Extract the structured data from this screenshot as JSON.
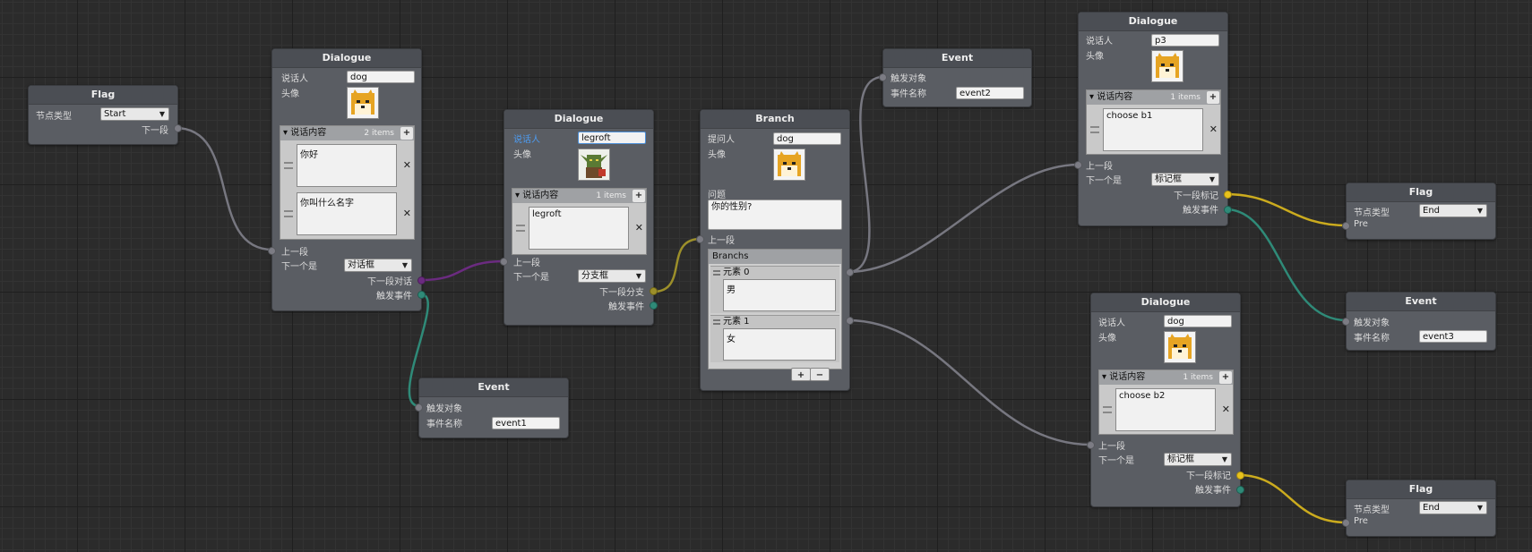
{
  "colors": {
    "background": "#2b2b2b",
    "node": "#5a5d63",
    "wire_default": "#777780",
    "wire_purple": "#6b2b80",
    "wire_teal": "#2f8a78",
    "wire_yellow": "#e8c21c",
    "label_focus": "#4d9bf0"
  },
  "nodes": {
    "flag_start": {
      "title": "Flag",
      "type_label": "节点类型",
      "type_value": "Start",
      "next_label": "下一段"
    },
    "dialogue1": {
      "title": "Dialogue",
      "speaker_label": "说话人",
      "speaker_value": "dog",
      "avatar_label": "头像",
      "avatar_icon": "shiba-dog-avatar",
      "list_label": "说话内容",
      "list_count": "2 items",
      "items": [
        "你好",
        "你叫什么名字"
      ],
      "prev_label": "上一段",
      "next_is_label": "下一个是",
      "next_is_value": "对话框",
      "next_dialogue_label": "下一段对话",
      "trigger_label": "触发事件"
    },
    "event1": {
      "title": "Event",
      "target_label": "触发对象",
      "name_label": "事件名称",
      "name_value": "event1"
    },
    "dialogue2": {
      "title": "Dialogue",
      "speaker_label": "说话人",
      "speaker_value": "legroft",
      "avatar_label": "头像",
      "avatar_icon": "goblin-avatar",
      "list_label": "说话内容",
      "list_count": "1 items",
      "items": [
        "legroft"
      ],
      "prev_label": "上一段",
      "next_is_label": "下一个是",
      "next_is_value": "分支框",
      "next_branch_label": "下一段分支",
      "trigger_label": "触发事件"
    },
    "branch": {
      "title": "Branch",
      "asker_label": "提问人",
      "asker_value": "dog",
      "avatar_label": "头像",
      "avatar_icon": "shiba-dog-avatar",
      "question_label": "问题",
      "question_value": "你的性别?",
      "prev_label": "上一段",
      "branchs_label": "Branchs",
      "elements": [
        {
          "label": "元素 0",
          "value": "男"
        },
        {
          "label": "元素 1",
          "value": "女"
        }
      ],
      "plus": "+",
      "minus": "−"
    },
    "event2": {
      "title": "Event",
      "target_label": "触发对象",
      "name_label": "事件名称",
      "name_value": "event2"
    },
    "dialogue3": {
      "title": "Dialogue",
      "speaker_label": "说话人",
      "speaker_value": "p3",
      "avatar_label": "头像",
      "avatar_icon": "shiba-dog-avatar",
      "list_label": "说话内容",
      "list_count": "1 items",
      "items": [
        "choose b1"
      ],
      "prev_label": "上一段",
      "next_is_label": "下一个是",
      "next_is_value": "标记框",
      "next_flag_label": "下一段标记",
      "trigger_label": "触发事件"
    },
    "dialogue4": {
      "title": "Dialogue",
      "speaker_label": "说话人",
      "speaker_value": "dog",
      "avatar_label": "头像",
      "avatar_icon": "shiba-dog-avatar",
      "list_label": "说话内容",
      "list_count": "1 items",
      "items": [
        "choose b2"
      ],
      "prev_label": "上一段",
      "next_is_label": "下一个是",
      "next_is_value": "标记框",
      "next_flag_label": "下一段标记",
      "trigger_label": "触发事件"
    },
    "flag_end1": {
      "title": "Flag",
      "type_label": "节点类型",
      "type_value": "End",
      "pre_label": "Pre"
    },
    "event3": {
      "title": "Event",
      "target_label": "触发对象",
      "name_label": "事件名称",
      "name_value": "event3"
    },
    "flag_end2": {
      "title": "Flag",
      "type_label": "节点类型",
      "type_value": "End",
      "pre_label": "Pre"
    }
  }
}
